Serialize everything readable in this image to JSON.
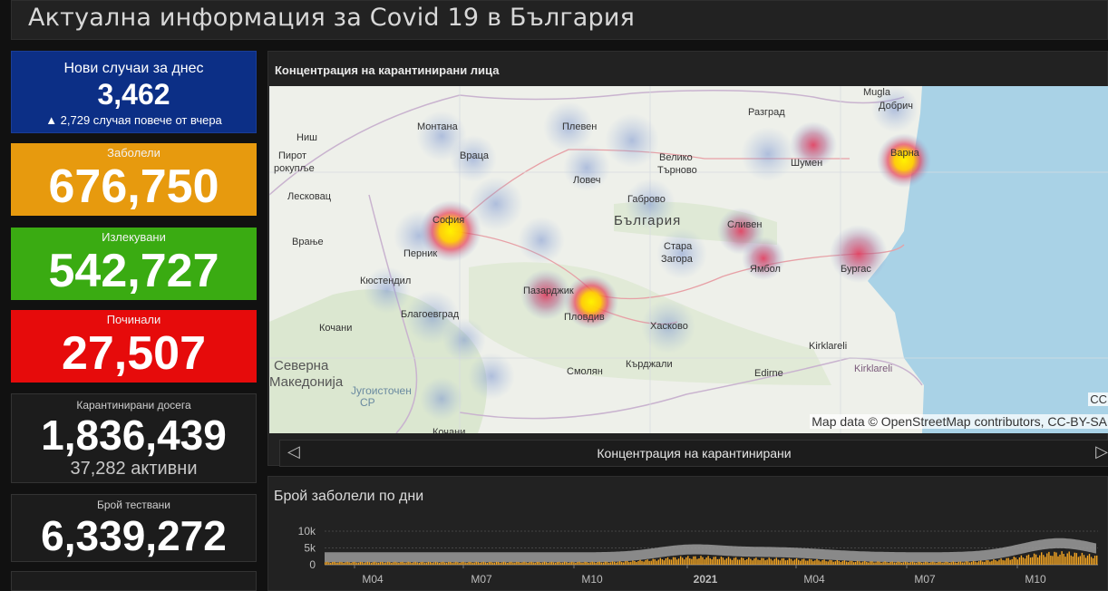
{
  "header": {
    "title": "Актуална информация за Covid 19 в България"
  },
  "cards": {
    "new_cases": {
      "label": "Нови случаи за днес",
      "value": "3,462",
      "change": "▲ 2,729 случая повече от вчера",
      "color": "#0c2f86"
    },
    "cases": {
      "label": "Заболели",
      "value": "676,750",
      "color": "#e79a0e"
    },
    "recovered": {
      "label": "Излекувани",
      "value": "542,727",
      "color": "#3aab12"
    },
    "deaths": {
      "label": "Починали",
      "value": "27,507",
      "color": "#e60b0b"
    },
    "quarantined": {
      "label": "Карантинирани досега",
      "value": "1,836,439",
      "active": "37,282 активни"
    },
    "tests": {
      "label": "Брой тествани",
      "value": "6,339,272"
    }
  },
  "map": {
    "title": "Концентрация на карантинирани лица",
    "attribution": "Map data © OpenStreetMap contributors, CC-BY-SA",
    "cc": "CC",
    "caption": "Концентрация на карантинирани",
    "prev_icon": "chevron-left-icon",
    "next_icon": "chevron-right-icon",
    "country_label": "България",
    "cities": [
      "Монтана",
      "Плевен",
      "Враца",
      "Велико Търново",
      "Ловеч",
      "Габрово",
      "Шумен",
      "Варна",
      "Добрич",
      "Разград",
      "София",
      "Перник",
      "Кюстендил",
      "Благоевград",
      "Пазарджик",
      "Пловдив",
      "Стара Загора",
      "Сливен",
      "Ямбол",
      "Бургас",
      "Хасково",
      "Кърджали",
      "Смолян",
      "Кочани",
      "Северна Македонија",
      "Edirne",
      "Kırklareli",
      "Ниш",
      "Пирот",
      "Лесковац",
      "Врање",
      "Mugla"
    ],
    "hotspot_colors": {
      "high": "#ffe600",
      "mid": "#e0405a",
      "low": "#8fa8d8"
    }
  },
  "chart": {
    "title": "Брой заболели по дни",
    "y_ticks": [
      "10k",
      "5k",
      "0"
    ],
    "x_ticks": [
      "M04",
      "M07",
      "M10",
      "2021",
      "M04",
      "M07",
      "M10"
    ],
    "bar_color": "#f5a623",
    "band_color": "#9b9b9b"
  }
}
